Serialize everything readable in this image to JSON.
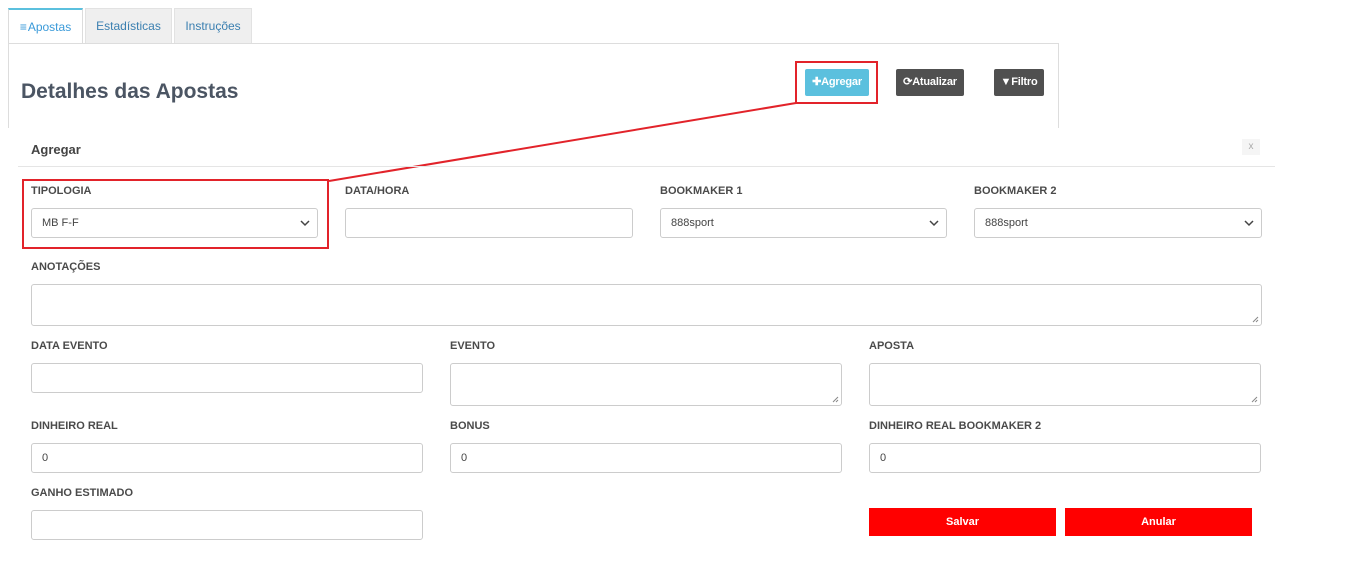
{
  "tabs": [
    {
      "label": "Apostas",
      "icon": "list-icon",
      "active": true
    },
    {
      "label": "Estadísticas",
      "active": false
    },
    {
      "label": "Instruções",
      "active": false
    }
  ],
  "header": {
    "title": "Detalhes das Apostas",
    "add_label": "Agregar",
    "refresh_label": "Atualizar",
    "filter_label": "Filtro"
  },
  "modal": {
    "title": "Agregar",
    "close_label": "x",
    "fields": {
      "tipologia": {
        "label": "TIPOLOGIA",
        "value": "MB F-F"
      },
      "data_hora": {
        "label": "DATA/HORA",
        "value": ""
      },
      "bookmaker1": {
        "label": "BOOKMAKER 1",
        "value": "888sport"
      },
      "bookmaker2": {
        "label": "BOOKMAKER 2",
        "value": "888sport"
      },
      "anotacoes": {
        "label": "ANOTAÇÕES",
        "value": ""
      },
      "data_evento": {
        "label": "DATA EVENTO",
        "value": ""
      },
      "evento": {
        "label": "EVENTO",
        "value": ""
      },
      "aposta": {
        "label": "APOSTA",
        "value": ""
      },
      "dinheiro_real": {
        "label": "DINHEIRO REAL",
        "value": "0"
      },
      "bonus": {
        "label": "BONUS",
        "value": "0"
      },
      "dinheiro_real_bm2": {
        "label": "DINHEIRO REAL BOOKMAKER 2",
        "value": "0"
      },
      "ganho_estimado": {
        "label": "GANHO ESTIMADO",
        "value": ""
      }
    },
    "save_label": "Salvar",
    "cancel_label": "Anular"
  },
  "colors": {
    "accent": "#5bc0de",
    "dark_button": "#505050",
    "danger": "#ff0000",
    "highlight": "#e2232a"
  }
}
